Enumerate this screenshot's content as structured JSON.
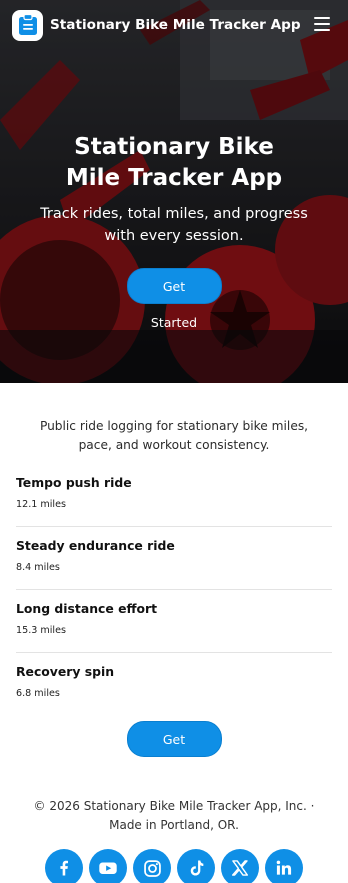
{
  "header": {
    "brand": "Stationary Bike Mile Tracker App",
    "logo_icon": "clipboard-list-icon",
    "menu_icon": "hamburger-menu-icon"
  },
  "hero": {
    "title": "Stationary Bike Mile Tracker App",
    "subtitle": "Track rides, total miles, and progress with every session.",
    "button_label": "Get Started"
  },
  "main": {
    "intro": "Public ride logging for stationary bike miles, pace, and workout consistency.",
    "rides": [
      {
        "title": "Tempo push ride",
        "miles": "12.1 miles"
      },
      {
        "title": "Steady endurance ride",
        "miles": "8.4 miles"
      },
      {
        "title": "Long distance effort",
        "miles": "15.3 miles"
      },
      {
        "title": "Recovery spin",
        "miles": "6.8 miles"
      }
    ],
    "cta_label": "Get Started"
  },
  "footer": {
    "text": "© 2026 Stationary Bike Mile Tracker App, Inc. · Made in Portland, OR.",
    "socials": [
      "facebook-icon",
      "youtube-icon",
      "instagram-icon",
      "tiktok-icon",
      "x-icon",
      "linkedin-icon"
    ]
  },
  "colors": {
    "accent": "#0f8fe6",
    "bike_red": "#b3161c"
  }
}
